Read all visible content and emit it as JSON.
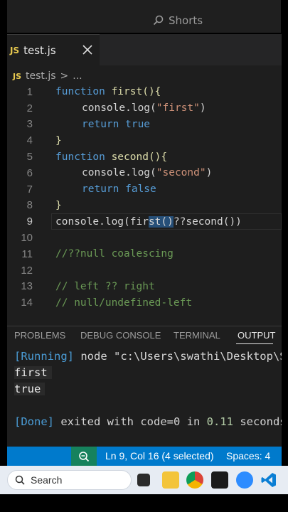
{
  "overlay": {
    "shorts_label": "Shorts"
  },
  "tab": {
    "icon": "JS",
    "filename": "test.js"
  },
  "breadcrumb": {
    "icon": "JS",
    "file": "test.js",
    "separator": ">",
    "ellipsis": "..."
  },
  "editor": {
    "line_numbers": [
      "1",
      "2",
      "3",
      "4",
      "5",
      "6",
      "7",
      "8",
      "9",
      "10",
      "11",
      "12",
      "13",
      "14"
    ],
    "active_line": "9",
    "lines": {
      "l1": {
        "kw": "function",
        "rest": " first(){"
      },
      "l2": {
        "pre": "console.log(",
        "str": "\"first\"",
        "post": ")"
      },
      "l3": {
        "kw": "return",
        "rest": " true"
      },
      "l4": {
        "text": "}"
      },
      "l5": {
        "kw": "function",
        "rest": " second(){"
      },
      "l6": {
        "pre": "console.log(",
        "str": "\"second\"",
        "post": ")"
      },
      "l7": {
        "kw": "return",
        "rest": " false"
      },
      "l8": {
        "text": "}"
      },
      "l9": {
        "pre": "console.log(fi",
        "mid_pre": "r",
        "sel": "st()",
        "post": "??second())"
      },
      "l10": {
        "text": ""
      },
      "l11": {
        "comment": "//??null coalescing"
      },
      "l12": {
        "text": ""
      },
      "l13": {
        "comment": "// left ?? right"
      },
      "l14": {
        "comment": "// null/undefined-left"
      }
    }
  },
  "panel": {
    "tabs": [
      "PROBLEMS",
      "DEBUG CONSOLE",
      "TERMINAL",
      "OUTPUT"
    ],
    "active_tab": "OUTPUT",
    "output": {
      "running_tag": "[Running]",
      "running_cmd": " node \"c:\\Users\\swathi\\Desktop\\S",
      "line_first": "first",
      "line_true": "true",
      "done_tag": "[Done]",
      "done_text": " exited with ",
      "code_label": "code=0",
      "in_text": " in ",
      "seconds_value": "0.11",
      "seconds_label": " seconds"
    }
  },
  "statusbar": {
    "position": "Ln 9, Col 16 (4 selected)",
    "spaces": "Spaces: 4"
  },
  "taskbar": {
    "search_placeholder": "Search"
  },
  "colors": {
    "statusbar_bg": "#007acc",
    "keyword": "#569cd6",
    "string": "#ce9178",
    "comment": "#6a9955",
    "js_badge": "#e8c94f"
  }
}
